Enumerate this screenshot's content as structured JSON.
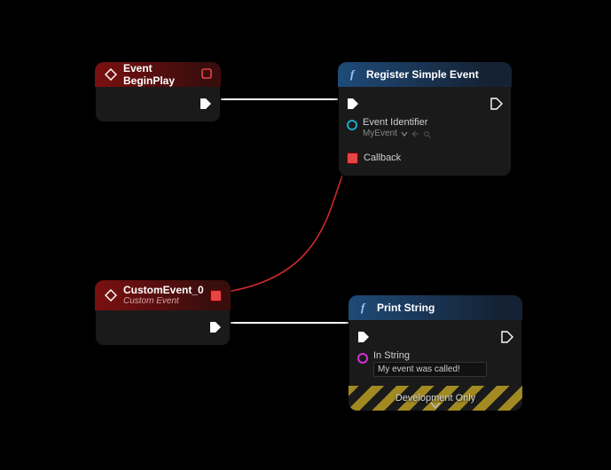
{
  "nodes": {
    "begin_play": {
      "title": "Event BeginPlay"
    },
    "register": {
      "title": "Register Simple Event",
      "pin_eventid_label": "Event Identifier",
      "pin_eventid_value": "MyEvent",
      "pin_callback_label": "Callback"
    },
    "custom_event": {
      "title": "CustomEvent_0",
      "subtitle": "Custom Event"
    },
    "print_string": {
      "title": "Print String",
      "pin_instring_label": "In String",
      "pin_instring_value": "My event was called!",
      "footer": "Development Only"
    }
  },
  "colors": {
    "exec_wire": "#ffffff",
    "delegate_wire": "#cc2b2b",
    "string_pin": "#d531d5",
    "object_pin": "#17a7c7",
    "delegate_pin": "#e64545"
  }
}
